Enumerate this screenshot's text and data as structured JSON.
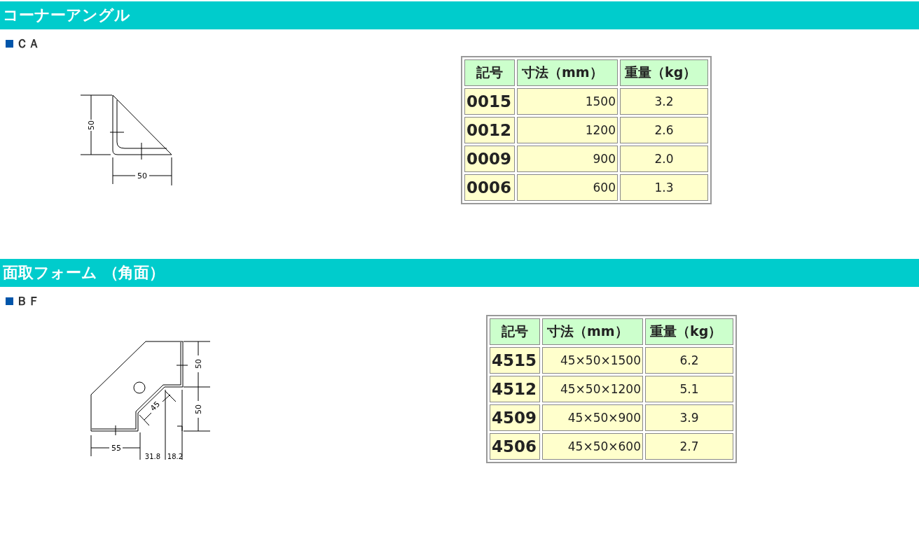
{
  "sections": [
    {
      "title": "コーナーアングル",
      "subtitle": "ＣＡ",
      "drawing": {
        "kind": "corner-angle",
        "labels": [
          "50",
          "50"
        ]
      },
      "table": {
        "columns": [
          "記号",
          "寸法（mm）",
          "重量（kg）"
        ],
        "rows": [
          {
            "code": "0015",
            "size": "1500",
            "weight": "3.2"
          },
          {
            "code": "0012",
            "size": "1200",
            "weight": "2.6"
          },
          {
            "code": "0009",
            "size": "900",
            "weight": "2.0"
          },
          {
            "code": "0006",
            "size": "600",
            "weight": "1.3"
          }
        ]
      }
    },
    {
      "title": "面取フォーム （角面）",
      "subtitle": "ＢＦ",
      "drawing": {
        "kind": "chamfer-form",
        "labels": [
          "50",
          "50",
          "45",
          "55",
          "31.8",
          "18.2"
        ]
      },
      "table": {
        "columns": [
          "記号",
          "寸法（mm）",
          "重量（kg）"
        ],
        "rows": [
          {
            "code": "4515",
            "size": "45×50×1500",
            "weight": "6.2"
          },
          {
            "code": "4512",
            "size": "45×50×1200",
            "weight": "5.1"
          },
          {
            "code": "4509",
            "size": "45×50×900",
            "weight": "3.9"
          },
          {
            "code": "4506",
            "size": "45×50×600",
            "weight": "2.7"
          }
        ]
      }
    }
  ]
}
